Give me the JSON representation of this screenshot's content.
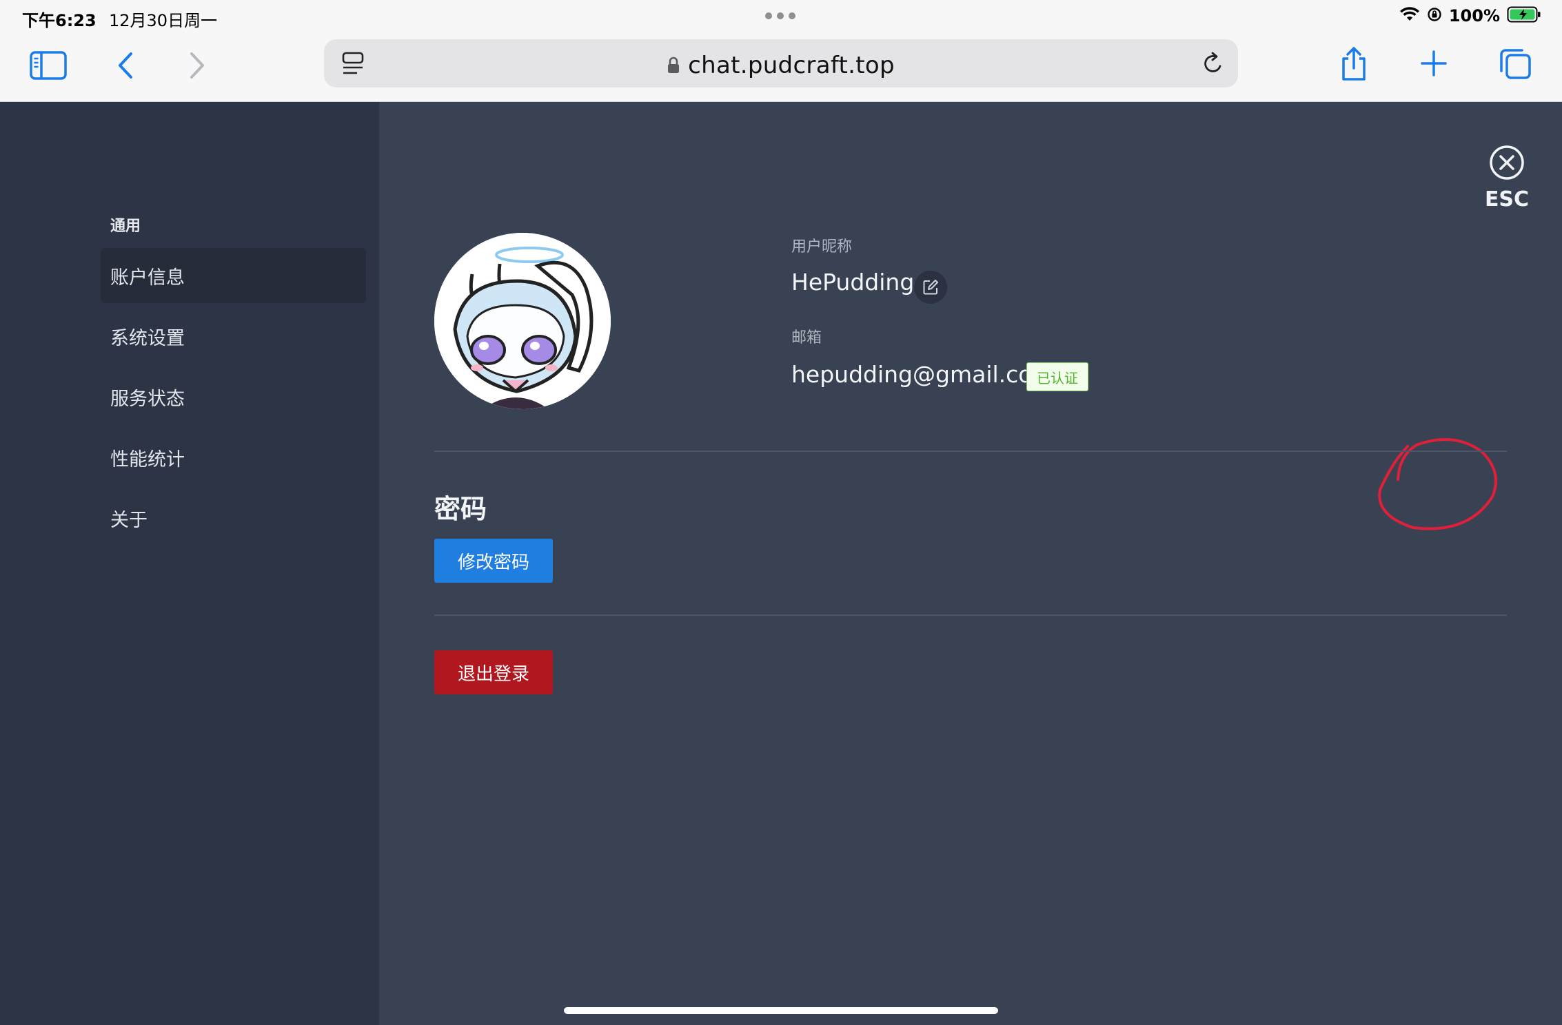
{
  "status_bar": {
    "time": "下午6:23",
    "date": "12月30日周一",
    "battery": "100%"
  },
  "browser": {
    "url": "chat.pudcraft.top"
  },
  "sidebar": {
    "section_title": "通用",
    "items": [
      {
        "label": "账户信息",
        "active": true
      },
      {
        "label": "系统设置",
        "active": false
      },
      {
        "label": "服务状态",
        "active": false
      },
      {
        "label": "性能统计",
        "active": false
      },
      {
        "label": "关于",
        "active": false
      }
    ]
  },
  "close": {
    "label": "ESC"
  },
  "profile": {
    "nickname_label": "用户昵称",
    "nickname": "HePudding",
    "email_label": "邮箱",
    "email": "hepudding@gmail.com",
    "verified_badge": "已认证"
  },
  "password": {
    "title": "密码",
    "change_button": "修改密码"
  },
  "logout_button": "退出登录",
  "colors": {
    "accent_blue": "#1f7ee0",
    "danger_red": "#b0171e",
    "verified_green": "#55b52f",
    "annotation_red": "#e0203a"
  }
}
